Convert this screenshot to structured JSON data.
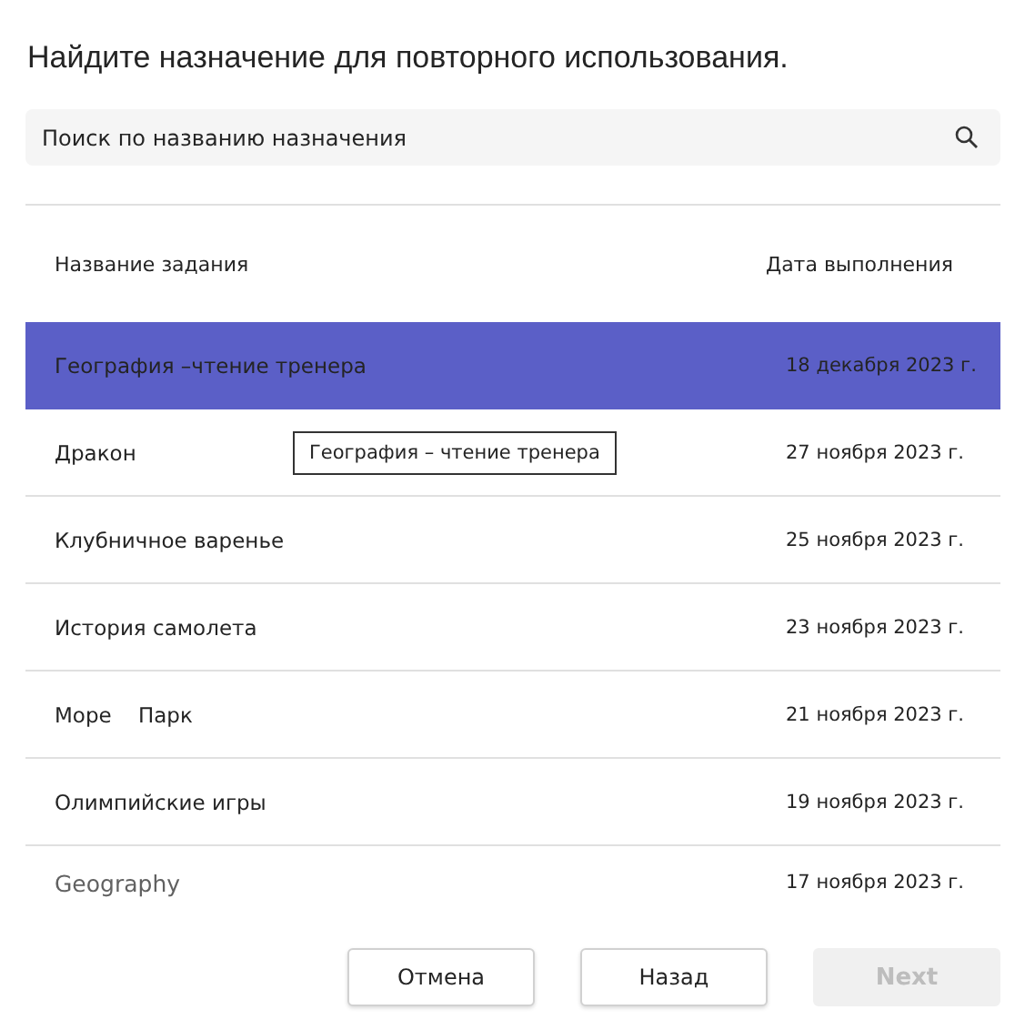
{
  "title": "Найдите назначение для повторного использования.",
  "search": {
    "placeholder": "Поиск по названию назначения"
  },
  "table": {
    "columns": [
      "Название задания",
      "Дата выполнения"
    ],
    "rows": [
      {
        "name": "География –чтение тренера",
        "date": "18 декабря 2023 г.",
        "selected": true
      },
      {
        "name": "Дракон",
        "date": "27 ноября 2023 г.",
        "selected": false
      },
      {
        "name": "Клубничное варенье",
        "date": "25 ноября 2023 г.",
        "selected": false
      },
      {
        "name": "История самолета",
        "date": "23 ноября 2023 г.",
        "selected": false
      },
      {
        "name": "Море    Парк",
        "date": "21 ноября 2023 г.",
        "selected": false
      },
      {
        "name": "Олимпийские игры",
        "date": "19 ноября 2023 г.",
        "selected": false
      },
      {
        "name": "Geography",
        "date": "17 ноября 2023 г.",
        "selected": false
      }
    ]
  },
  "tooltip": "География – чтение тренера",
  "buttons": [
    {
      "label": "Отмена",
      "disabled": false
    },
    {
      "label": "Назад",
      "disabled": false
    },
    {
      "label": "Next",
      "disabled": true
    }
  ]
}
